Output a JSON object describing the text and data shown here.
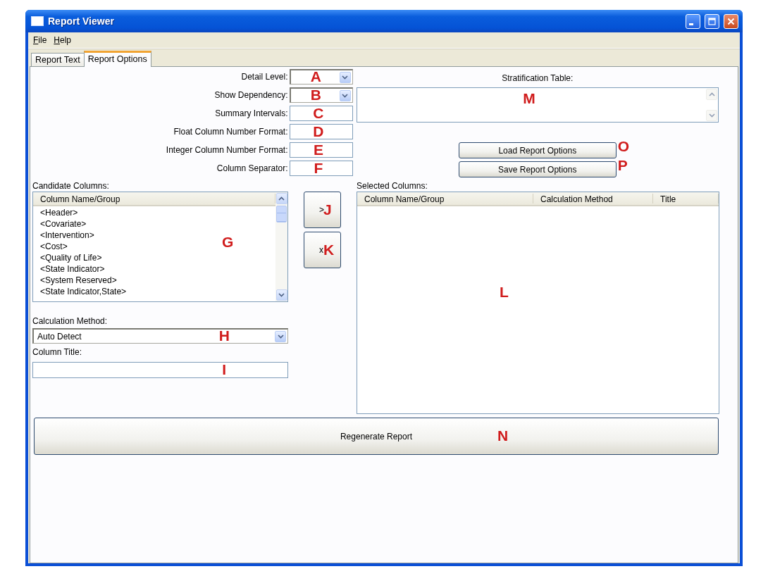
{
  "window": {
    "title": "Report Viewer"
  },
  "menu": [
    {
      "label": "File"
    },
    {
      "label": "Help"
    }
  ],
  "tabs": [
    {
      "label": "Report Text",
      "selected": false
    },
    {
      "label": "Report Options",
      "selected": true
    }
  ],
  "options": [
    {
      "kind": "combo",
      "label": "Detail Level:",
      "annotation": "A"
    },
    {
      "kind": "combo",
      "label": "Show Dependency:",
      "annotation": "B"
    },
    {
      "kind": "text",
      "label": "Summary Intervals:",
      "annotation": "C"
    },
    {
      "kind": "text",
      "label": "Float Column Number Format:",
      "annotation": "D"
    },
    {
      "kind": "text",
      "label": "Integer Column Number Format:",
      "annotation": "E"
    },
    {
      "kind": "text",
      "label": "Column Separator:",
      "annotation": "F"
    }
  ],
  "stratification_table": {
    "label": "Stratification Table:",
    "annotation": "M"
  },
  "option_buttons": [
    {
      "label": "Load Report Options",
      "annotation": "O"
    },
    {
      "label": "Save Report Options",
      "annotation": "P"
    }
  ],
  "candidate_columns": {
    "label": "Candidate Columns:",
    "column": "Column Name/Group",
    "annotation": "G",
    "items": [
      "<Header>",
      "<Covariate>",
      "<Intervention>",
      "<Cost>",
      "<Quality of Life>",
      "<State Indicator>",
      "<System Reserved>",
      "<State Indicator,State>"
    ]
  },
  "move_buttons": [
    {
      "label": ">",
      "annotation": "J"
    },
    {
      "label": "x",
      "annotation": "K"
    }
  ],
  "calculation_method": {
    "label": "Calculation Method:",
    "value": "Auto Detect",
    "annotation": "H"
  },
  "column_title": {
    "label": "Column Title:",
    "annotation": "I"
  },
  "selected_columns": {
    "label": "Selected Columns:",
    "columns": [
      "Column Name/Group",
      "Calculation Method",
      "Title"
    ],
    "annotation": "L"
  },
  "regenerate_button": {
    "label": "Regenerate Report",
    "annotation": "N"
  }
}
